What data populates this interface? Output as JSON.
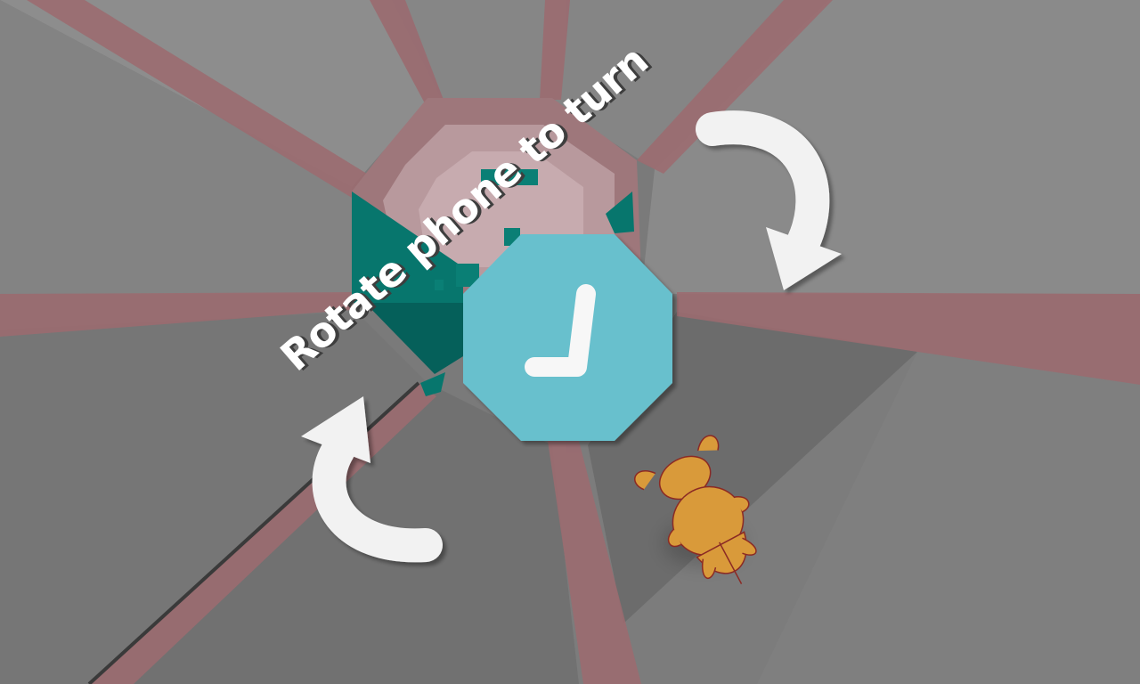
{
  "game": {
    "hint_text": "Rotate phone to turn",
    "confirm_button_icon": "checkmark-icon",
    "player_character": "beetle",
    "colors": {
      "tunnel_panel_light": "#8a8a8a",
      "tunnel_panel_mid": "#7b7b7b",
      "tunnel_panel_dark": "#6a6a6a",
      "tunnel_beam": "#9a6a6e",
      "tunnel_core": "#c0a0a4",
      "obstacle_teal": "#06736b",
      "confirm_button": "#68c0cd",
      "arrow": "#f2f2f2",
      "beetle": "#d99a3a"
    }
  }
}
